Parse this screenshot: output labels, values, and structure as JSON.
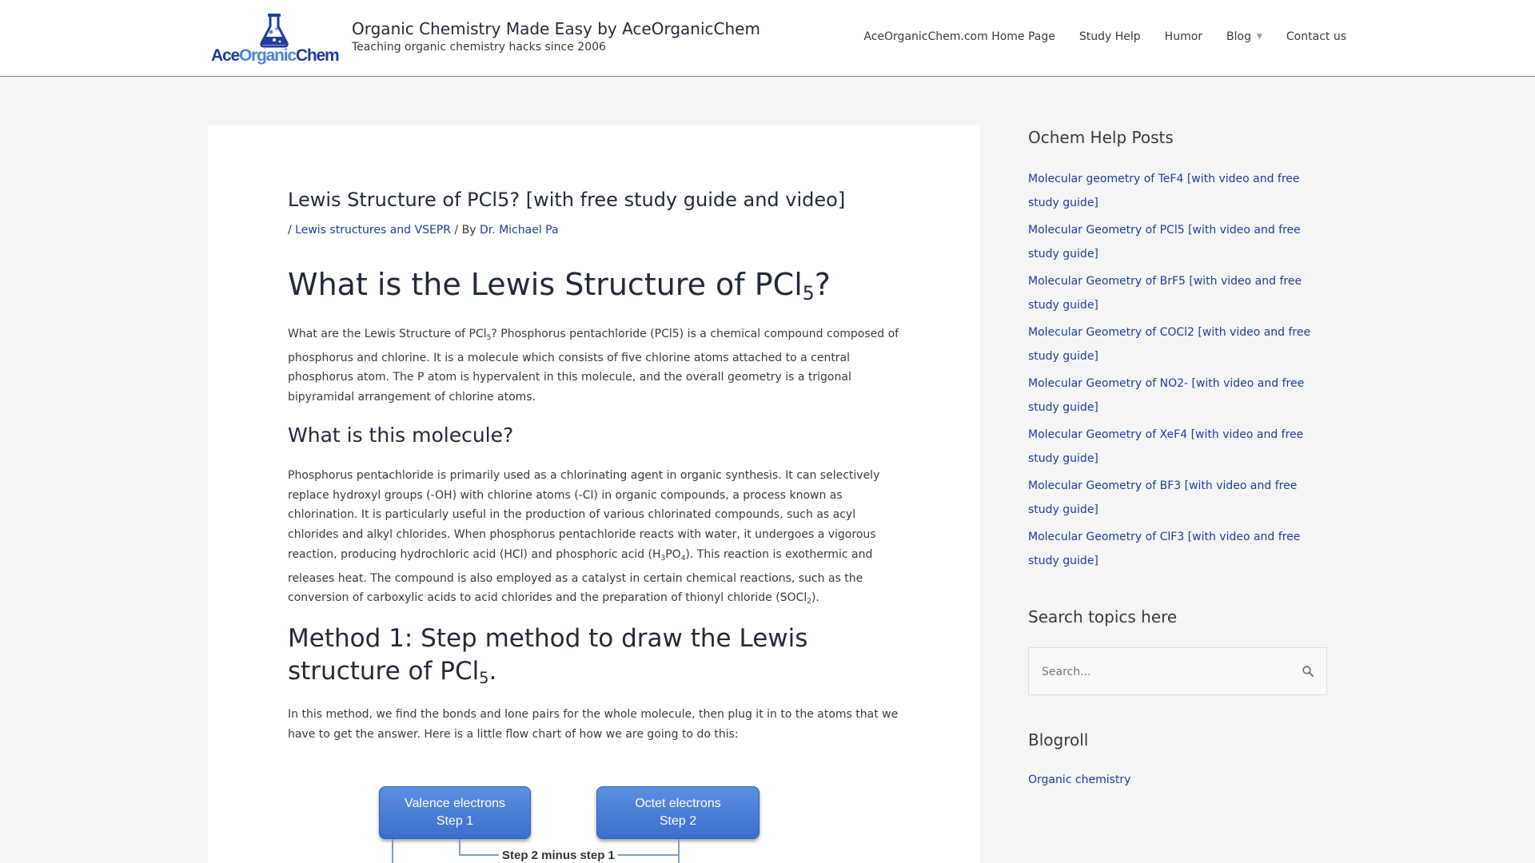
{
  "header": {
    "logo_text": {
      "ace": "Ace",
      "organic": "Organic",
      "chem": "Chem"
    },
    "site_title": "Organic Chemistry Made Easy by AceOrganicChem",
    "tagline": "Teaching organic chemistry hacks since 2006",
    "nav": [
      {
        "label": "AceOrganicChem.com Home Page"
      },
      {
        "label": "Study Help"
      },
      {
        "label": "Humor"
      },
      {
        "label": "Blog",
        "has_dropdown": true
      },
      {
        "label": "Contact us"
      }
    ]
  },
  "article": {
    "title": "Lewis Structure of PCl5? [with free study guide and video]",
    "meta": {
      "prefix": "/ ",
      "category": "Lewis structures and VSEPR",
      "by": " / By ",
      "author": "Dr. Michael Pa"
    },
    "h1": {
      "text": "What is the Lewis Structure of PCl",
      "sub": "5",
      "end": "?"
    },
    "p1": {
      "a": "What are the Lewis Structure of PCl",
      "sub": "5",
      "b": "? Phosphorus pentachloride (PCl5) is a chemical compound composed of phosphorus and chlorine. It is a molecule which consists of five chlorine atoms attached to a central phosphorus atom. The P atom is hypervalent in this molecule, and the overall geometry is a trigonal bipyramidal arrangement of chlorine atoms."
    },
    "h2": "What is this molecule?",
    "p2": {
      "a": "Phosphorus pentachloride is primarily used as a chlorinating agent in organic synthesis. It can selectively replace hydroxyl groups (-OH) with chlorine atoms (-Cl) in organic compounds, a process known as chlorination. It is particularly useful in the production of various chlorinated compounds, such as acyl chlorides and alkyl chlorides. When phosphorus pentachloride reacts with water, it undergoes a vigorous reaction, producing hydrochloric acid (HCl) and phosphoric acid (H",
      "sub1": "3",
      "b": "PO",
      "sub2": "4",
      "c": "). This reaction is exothermic and releases heat. The compound is also employed as a catalyst in certain chemical reactions, such as the conversion of carboxylic acids to acid chlorides and the preparation of thionyl chloride (SOCl",
      "sub3": "2",
      "d": ")."
    },
    "h3": {
      "text": "Method 1: Step method to draw the Lewis structure of PCl",
      "sub": "5",
      "end": "."
    },
    "p3": "In this method, we find the bonds and lone pairs for the whole molecule, then plug it in to the atoms that we have to get the answer. Here is a little flow chart of how we are going to do this:",
    "flowchart": {
      "box1": {
        "line1": "Valence electrons",
        "line2": "Step 1"
      },
      "box2": {
        "line1": "Octet electrons",
        "line2": "Step 2"
      },
      "label": "Step 2 minus step 1"
    }
  },
  "sidebar": {
    "posts_title": "Ochem Help Posts",
    "posts": [
      "Molecular geometry of TeF4 [with video and free study guide]",
      "Molecular Geometry of PCl5 [with video and free study guide]",
      "Molecular Geometry of BrF5 [with video and free study guide]",
      "Molecular Geometry of COCl2 [with video and free study guide]",
      "Molecular Geometry of NO2- [with video and free study guide]",
      "Molecular Geometry of XeF4 [with video and free study guide]",
      "Molecular Geometry of BF3 [with video and free study guide]",
      "Molecular Geometry of ClF3 [with video and free study guide]"
    ],
    "search_title": "Search topics here",
    "search_placeholder": "Search...",
    "blogroll_title": "Blogroll",
    "blogroll_link": "Organic chemistry"
  },
  "colors": {
    "link": "#1f3d9a",
    "heading": "#222a3a",
    "accent_light": "#4b86d6"
  },
  "icons": {
    "logo": "flask-icon",
    "search": "search-icon",
    "dropdown": "chevron-down-icon"
  }
}
